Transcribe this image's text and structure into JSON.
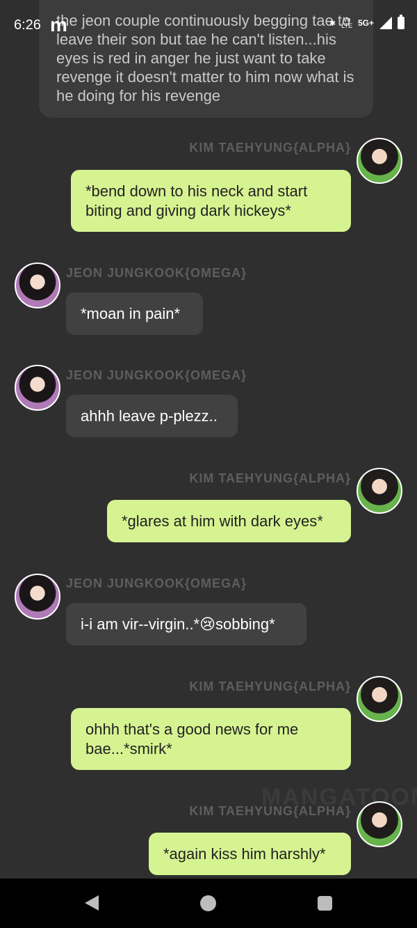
{
  "status": {
    "time": "6:26",
    "app_glyph": "m",
    "bluetooth_icon": "bluetooth-icon",
    "volte": "Vo",
    "lte": "LTE",
    "network": "5G+"
  },
  "narration": "the jeon couple continuously begging tae to leave their son but tae he can't listen...his eyes is red in anger he just want to take revenge it doesn't matter to him now what is he doing for his revenge",
  "names": {
    "tae": "KIM TAEHYUNG{ALPHA}",
    "jk": "JEON JUNGKOOK{OMEGA}"
  },
  "messages": [
    {
      "text": "*bend down to his neck and start biting and giving dark hickeys*"
    },
    {
      "text": "*moan in pain*"
    },
    {
      "text": "ahhh leave p-plezz.."
    },
    {
      "text": "*glares at him with dark eyes*"
    },
    {
      "text": "i-i am vir--virgin..*😢sobbing*"
    },
    {
      "text": "ohhh that's a good news for me bae...*smirk*"
    },
    {
      "text": "*again kiss him harshly*"
    }
  ],
  "watermark": "MANGATOON",
  "colors": {
    "background": "#2f2f2f",
    "outgoing_bubble": "#d6f391",
    "incoming_bubble": "#414141",
    "name_text": "#5e5e5e"
  }
}
